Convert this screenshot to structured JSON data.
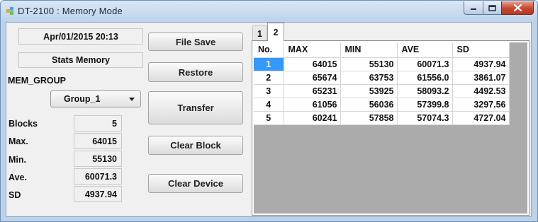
{
  "window": {
    "title": "DT-2100 : Memory Mode",
    "controls": {
      "minimize_icon": "minimize-icon",
      "maximize_icon": "maximize-icon",
      "close_icon": "close-icon"
    }
  },
  "left_panel": {
    "datetime": "Apr/01/2015 20:13",
    "mode_label": "Stats Memory",
    "mem_group_label": "MEM_GROUP",
    "group_select": {
      "selected": "Group_1"
    },
    "stats": [
      {
        "label": "Blocks",
        "value": "5"
      },
      {
        "label": "Max.",
        "value": "64015"
      },
      {
        "label": "Min.",
        "value": "55130"
      },
      {
        "label": "Ave.",
        "value": "60071.3"
      },
      {
        "label": "SD",
        "value": "4937.94"
      }
    ]
  },
  "buttons": {
    "file_save": "File Save",
    "restore": "Restore",
    "transfer": "Transfer",
    "clear_block": "Clear Block",
    "clear_device": "Clear Device"
  },
  "tabs": [
    {
      "label": "1"
    },
    {
      "label": "2"
    }
  ],
  "table": {
    "columns": [
      "No.",
      "MAX",
      "MIN",
      "AVE",
      "SD"
    ],
    "rows": [
      [
        "1",
        "64015",
        "55130",
        "60071.3",
        "4937.94"
      ],
      [
        "2",
        "65674",
        "63753",
        "61556.0",
        "3861.07"
      ],
      [
        "3",
        "65231",
        "53925",
        "58093.2",
        "4492.53"
      ],
      [
        "4",
        "61056",
        "56036",
        "57399.8",
        "3297.56"
      ],
      [
        "5",
        "60241",
        "57858",
        "57074.3",
        "4727.04"
      ]
    ],
    "selected_row": 1
  },
  "colors": {
    "selection": "#3399ff",
    "window_frame": "#bcd2ea",
    "close_button": "#c6452c"
  }
}
